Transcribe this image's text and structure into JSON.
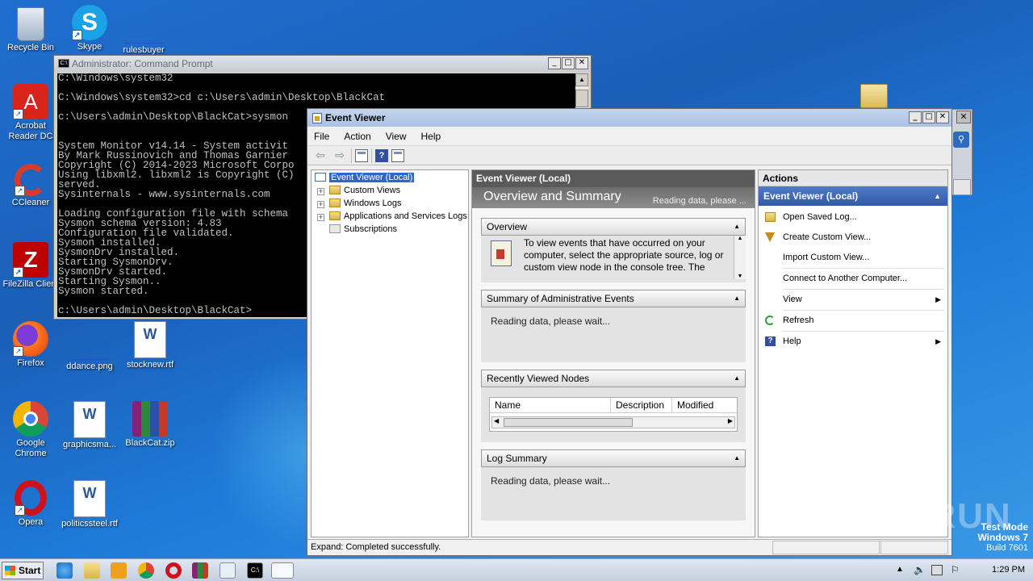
{
  "desktop": {
    "icons": [
      {
        "label": "Recycle Bin"
      },
      {
        "label": "Skype"
      },
      {
        "label": "rulesbuyer"
      },
      {
        "label": "Acrobat Reader DC"
      },
      {
        "label": "CCleaner"
      },
      {
        "label": "FileZilla Client"
      },
      {
        "label": "Firefox"
      },
      {
        "label": "ddance.png"
      },
      {
        "label": "stocknew.rtf"
      },
      {
        "label": "Google Chrome"
      },
      {
        "label": "graphicsma..."
      },
      {
        "label": "BlackCat.zip"
      },
      {
        "label": "Opera"
      },
      {
        "label": "politicssteel.rtf"
      }
    ]
  },
  "cmd": {
    "title": "Administrator: Command Prompt",
    "icon_text": "C:\\",
    "lines": "C:\\Windows\\system32\n\nC:\\Windows\\system32>cd c:\\Users\\admin\\Desktop\\BlackCat\n\nc:\\Users\\admin\\Desktop\\BlackCat>sysmon\n\n\nSystem Monitor v14.14 - System activit\nBy Mark Russinovich and Thomas Garnier\nCopyright (C) 2014-2023 Microsoft Corpo\nUsing libxml2. libxml2 is Copyright (C)\nserved.\nSysinternals - www.sysinternals.com\n\nLoading configuration file with schema\nSysmon schema version: 4.83\nConfiguration file validated.\nSysmon installed.\nSysmonDrv installed.\nStarting SysmonDrv.\nSysmonDrv started.\nStarting Sysmon..\nSysmon started.\n\nc:\\Users\\admin\\Desktop\\BlackCat>"
  },
  "event_viewer": {
    "title": "Event Viewer",
    "menu": [
      "File",
      "Action",
      "View",
      "Help"
    ],
    "tree": {
      "root": "Event Viewer (Local)",
      "children": [
        "Custom Views",
        "Windows Logs",
        "Applications and Services Logs",
        "Subscriptions"
      ]
    },
    "center": {
      "header": "Event Viewer (Local)",
      "banner_title": "Overview and Summary",
      "banner_status": "Reading data, please ...",
      "overview": {
        "title": "Overview",
        "text": "To view events that have occurred on your computer, select the appropriate source, log or custom view node in the console tree. The"
      },
      "summary": {
        "title": "Summary of Administrative Events",
        "text": "Reading data, please wait..."
      },
      "recent": {
        "title": "Recently Viewed Nodes",
        "columns": [
          "Name",
          "Description",
          "Modified"
        ]
      },
      "log_summary": {
        "title": "Log Summary",
        "text": "Reading data, please wait..."
      }
    },
    "actions": {
      "title": "Actions",
      "section": "Event Viewer (Local)",
      "items": [
        "Open Saved Log...",
        "Create Custom View...",
        "Import Custom View...",
        "Connect to Another Computer...",
        "View",
        "Refresh",
        "Help"
      ]
    },
    "status": {
      "text": "Expand:  Completed successfully."
    }
  },
  "taskbar": {
    "start_label": "Start",
    "clock": "1:29 PM"
  },
  "watermark": {
    "brand": "ANY RUN",
    "mode": "Test Mode",
    "os": "Windows 7",
    "build": "Build 7601"
  },
  "colors": {
    "accent": "#3165c6",
    "desktop": "#1a5fb8",
    "console_bg": "#000000"
  }
}
